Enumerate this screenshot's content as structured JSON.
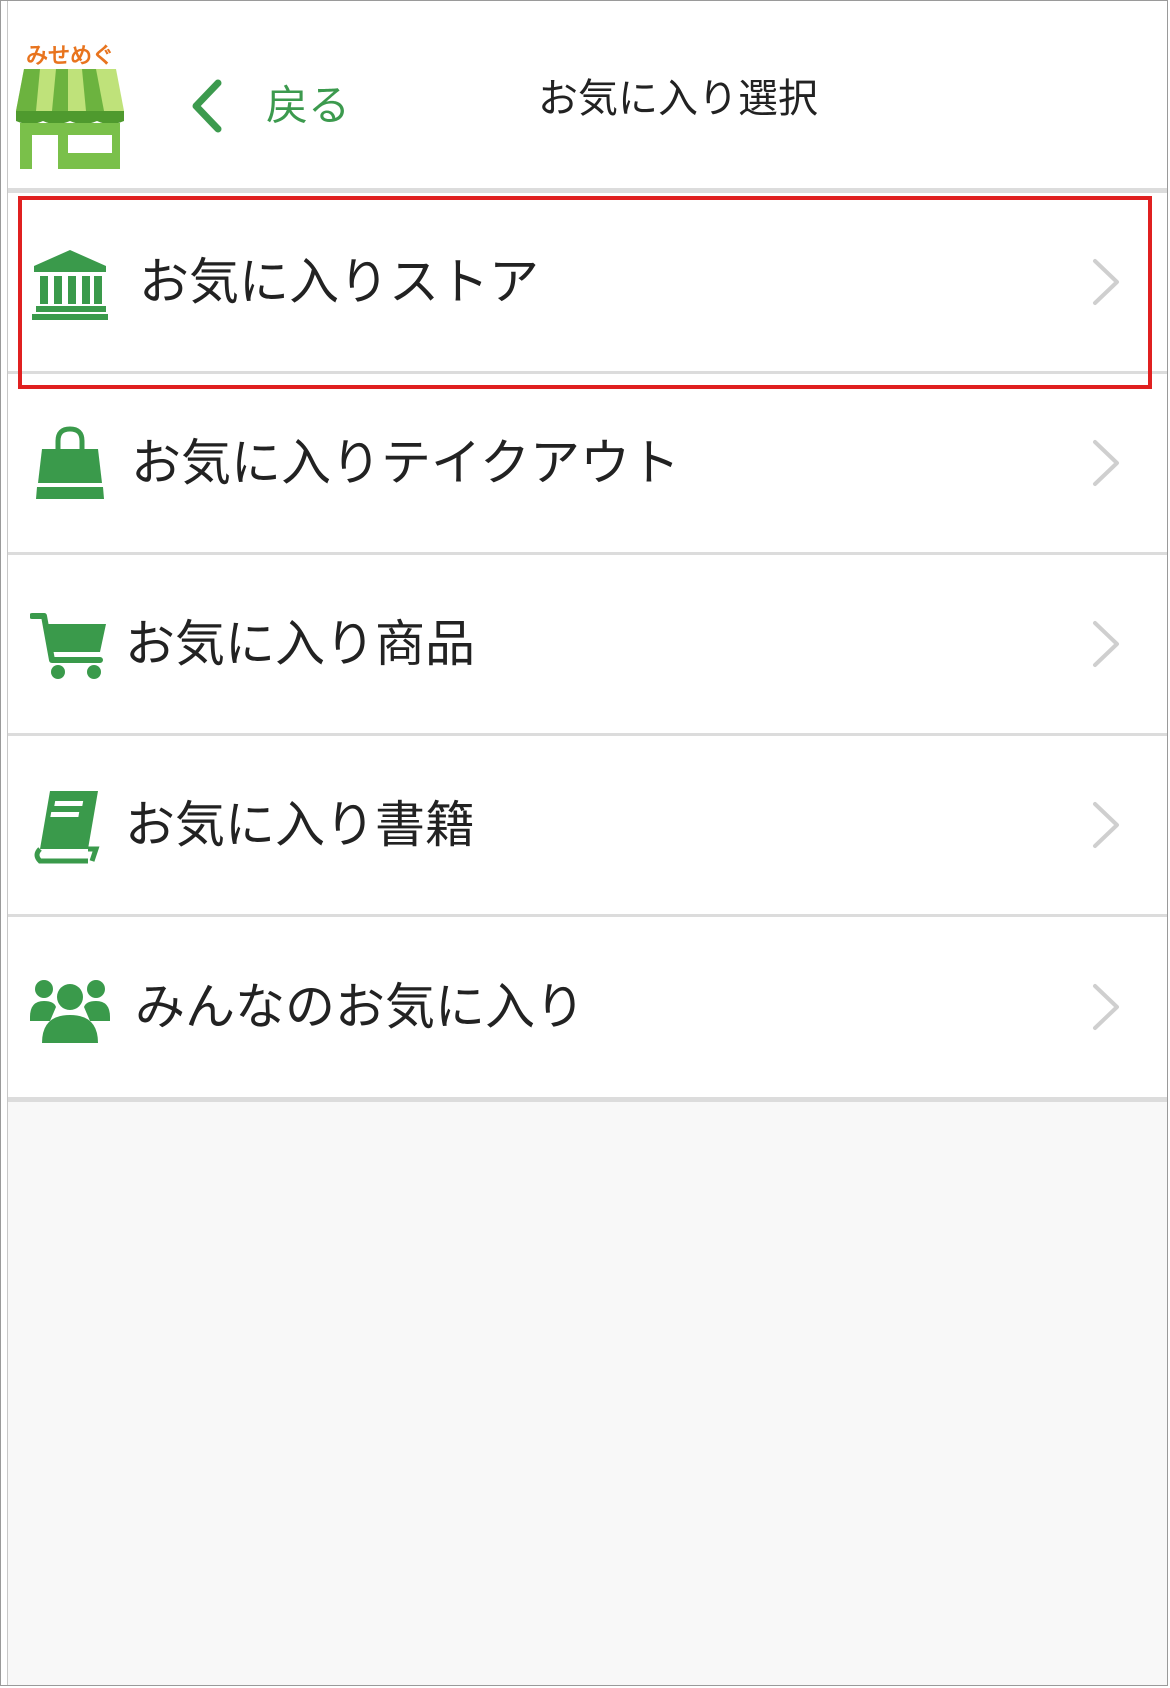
{
  "logo": {
    "text": "みせめぐ"
  },
  "header": {
    "back_label": "戻る",
    "title": "お気に入り選択"
  },
  "items": [
    {
      "label": "お気に入りストア",
      "icon": "bank-icon"
    },
    {
      "label": "お気に入りテイクアウト",
      "icon": "shopping-bag-icon"
    },
    {
      "label": "お気に入り商品",
      "icon": "cart-icon"
    },
    {
      "label": "お気に入り書籍",
      "icon": "book-icon"
    },
    {
      "label": "みんなのお気に入り",
      "icon": "users-icon"
    }
  ],
  "colors": {
    "accent_green": "#3a9a4b",
    "logo_orange": "#e8741e",
    "highlight_red": "#e02020",
    "chevron_gray": "#cfcfcf"
  }
}
